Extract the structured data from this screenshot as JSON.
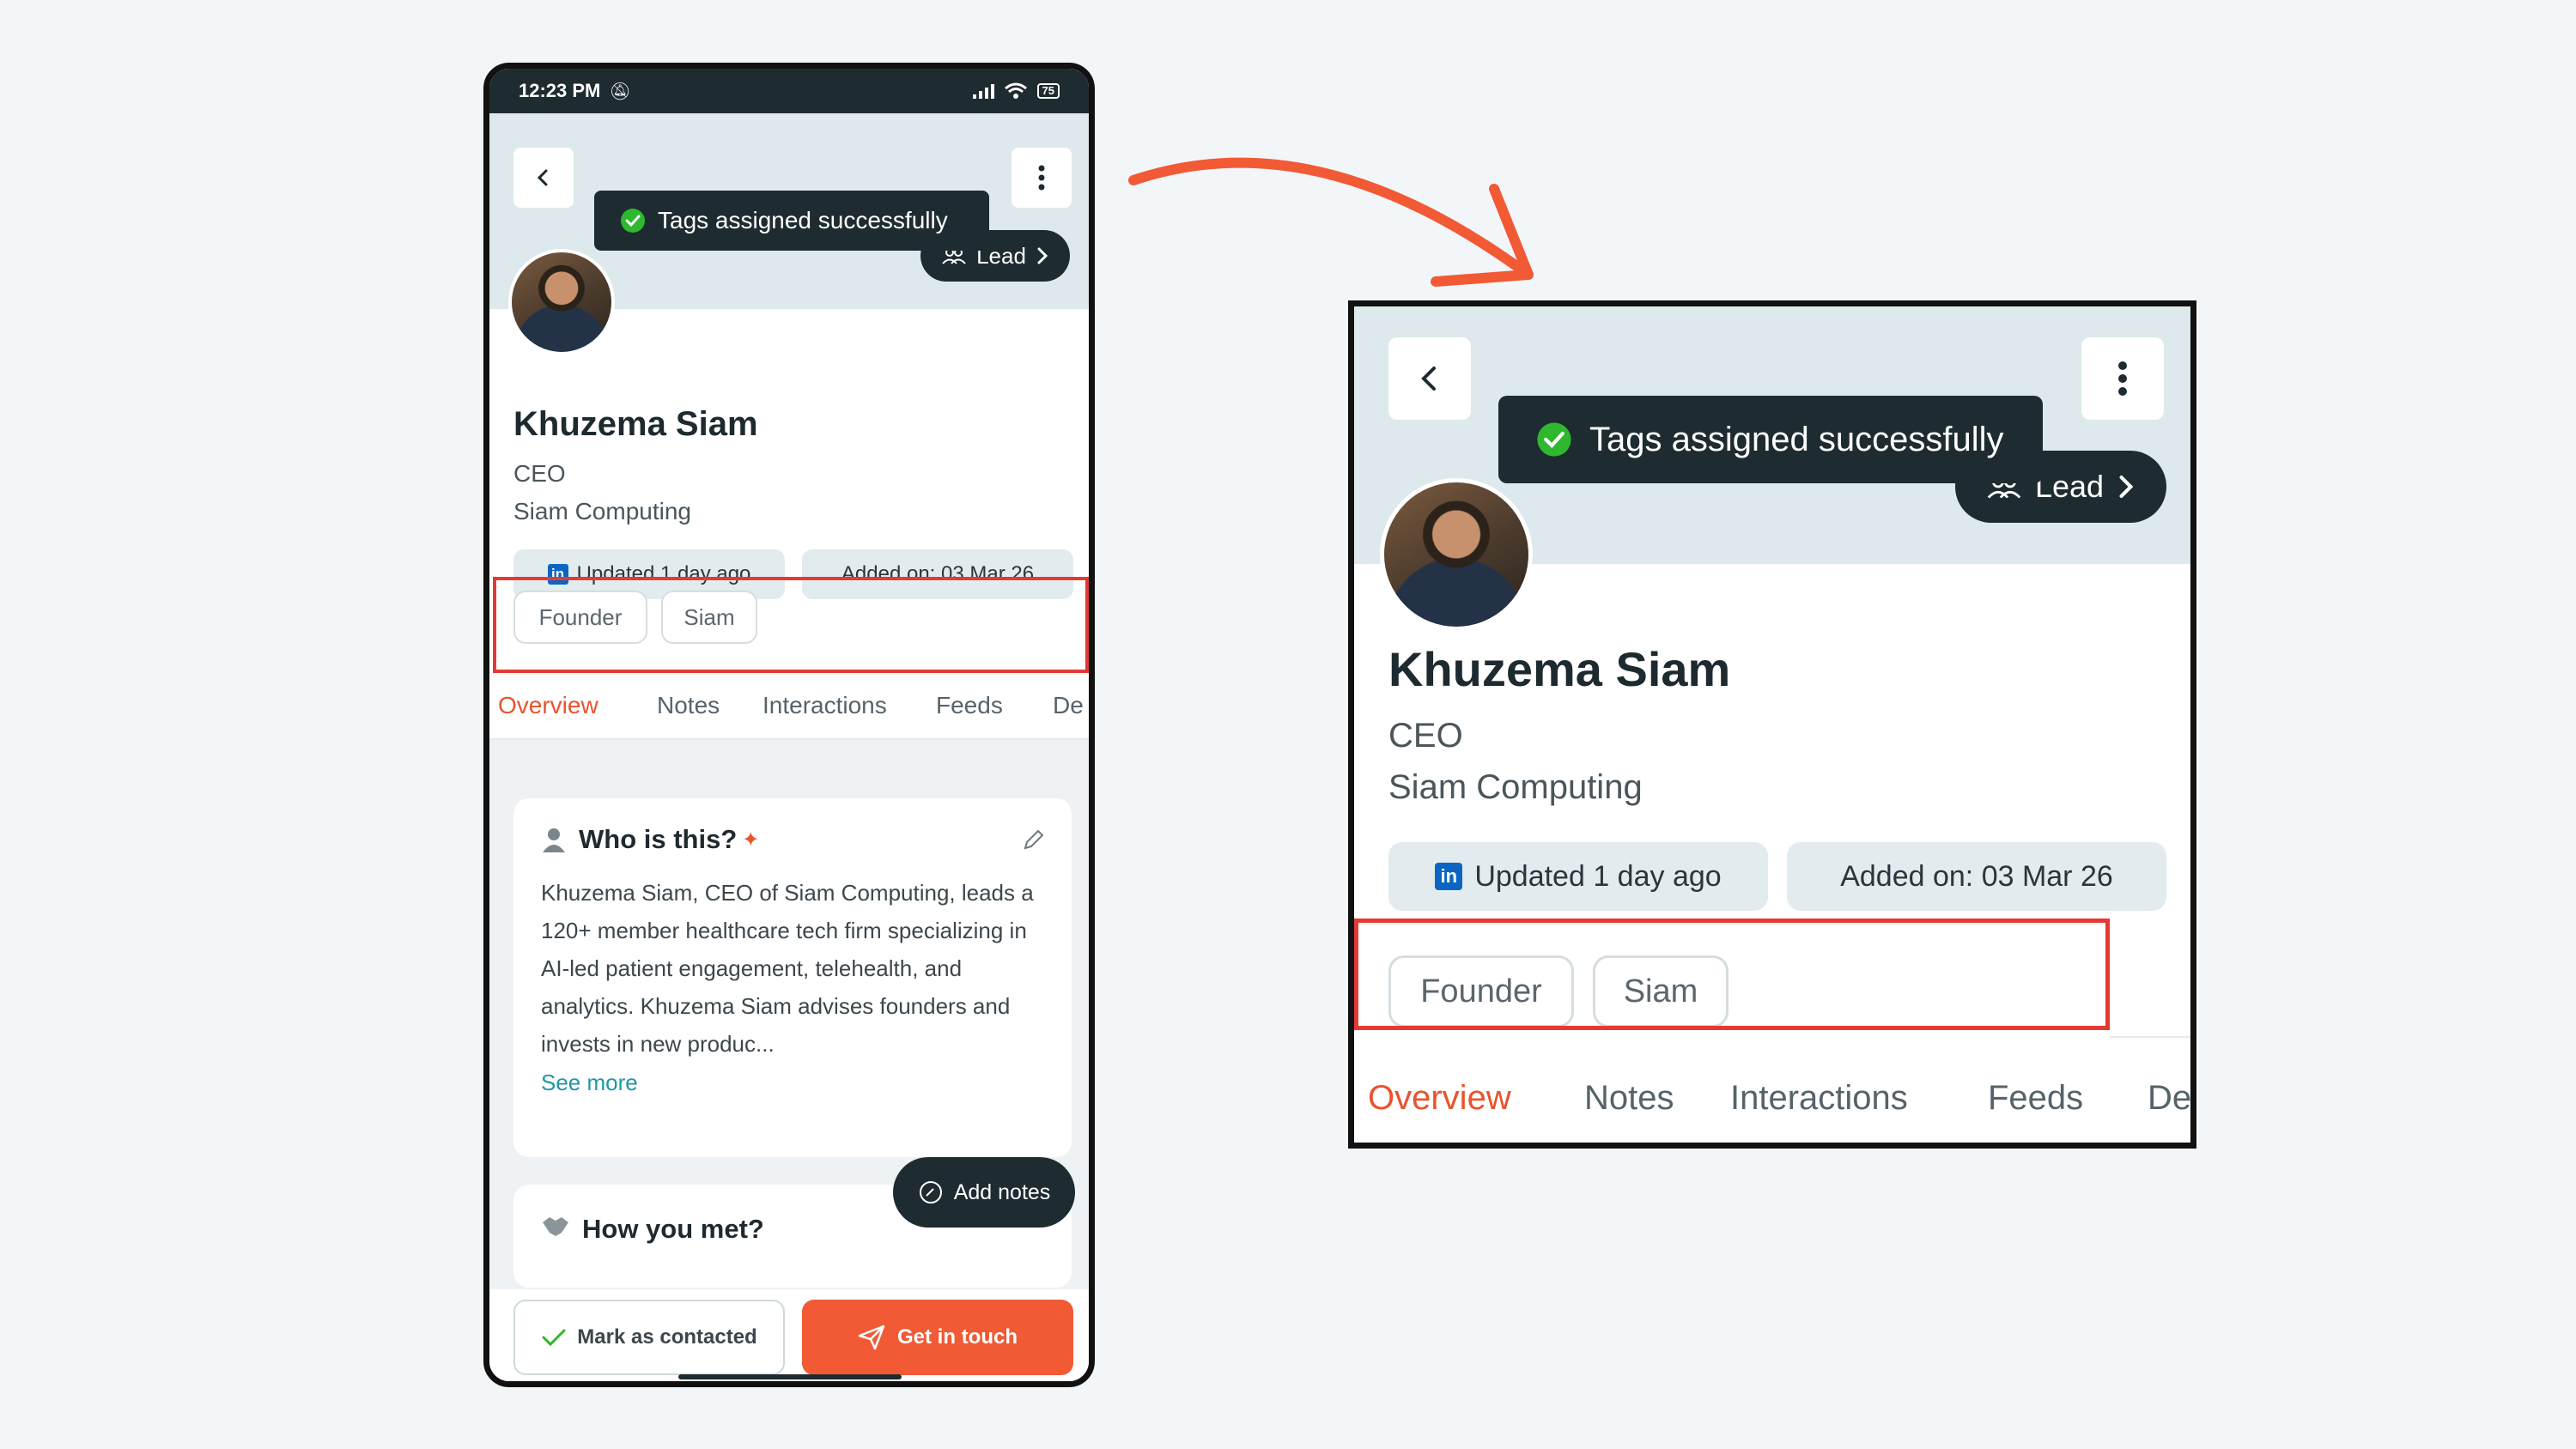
{
  "status_bar": {
    "time": "12:23 PM",
    "battery": "75"
  },
  "header": {
    "toast": "Tags assigned successfully",
    "lead_label": "Lead"
  },
  "profile": {
    "name": "Khuzema Siam",
    "title": "CEO",
    "company": "Siam Computing",
    "updated": "Updated 1 day ago",
    "added": "Added on: 03 Mar 26",
    "linkedin_icon_text": "in"
  },
  "tags": [
    "Founder",
    "Siam"
  ],
  "tabs": [
    "Overview",
    "Notes",
    "Interactions",
    "Feeds",
    "De"
  ],
  "zoom_tabs": [
    "Overview",
    "Notes",
    "Interactions",
    "Feeds",
    "Det"
  ],
  "who_card": {
    "title": "Who is this?",
    "sparkle": "✦",
    "body": "Khuzema Siam, CEO of Siam Computing, leads a 120+ member healthcare tech firm specializing in AI-led patient engagement, telehealth, and analytics. Khuzema Siam advises founders and invests in new produc...",
    "see_more": "See more"
  },
  "met_card": {
    "title": "How you met?"
  },
  "add_notes": "Add notes",
  "actions": {
    "mark_contacted": "Mark as contacted",
    "get_in_touch": "Get in touch"
  },
  "colors": {
    "accent": "#f15a35",
    "dark": "#1e2b31",
    "hero": "#dde9ec",
    "highlight": "#e53935",
    "link": "#2196a6",
    "success": "#2eb82e"
  },
  "icons": {
    "back": "chevron-left-icon",
    "more": "kebab-icon",
    "success": "check-circle-icon",
    "lead": "people-icon",
    "edit": "pencil-icon",
    "person": "person-icon",
    "send": "paper-plane-icon"
  }
}
